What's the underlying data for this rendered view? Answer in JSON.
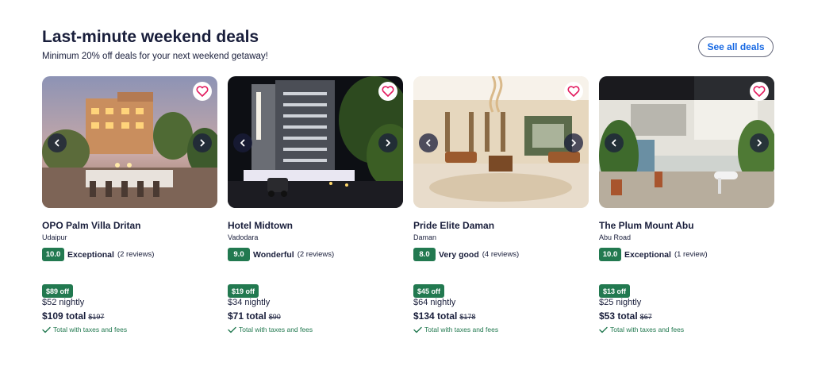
{
  "header": {
    "title": "Last-minute weekend deals",
    "subtitle": "Minimum 20% off deals for your next weekend getaway!",
    "see_all_label": "See all deals"
  },
  "colors": {
    "accent_link": "#1668e3",
    "rating_green": "#227950",
    "favorite_heart": "#e31c5f",
    "text_dark": "#191e3b"
  },
  "icons": {
    "favorite": "heart-outline-icon",
    "previous": "chevron-left-icon",
    "next": "chevron-right-icon",
    "included": "check-icon"
  },
  "cards": [
    {
      "name": "OPO Palm Villa Dritan",
      "location": "Udaipur",
      "score": "10.0",
      "rating_label": "Exceptional",
      "reviews": "(2 reviews)",
      "discount": "$89 off",
      "nightly": "$52 nightly",
      "total": "$109 total",
      "original_total": "$197",
      "taxes_note": "Total with taxes and fees"
    },
    {
      "name": "Hotel Midtown",
      "location": "Vadodara",
      "score": "9.0",
      "rating_label": "Wonderful",
      "reviews": "(2 reviews)",
      "discount": "$19 off",
      "nightly": "$34 nightly",
      "total": "$71 total",
      "original_total": "$90",
      "taxes_note": "Total with taxes and fees"
    },
    {
      "name": "Pride Elite Daman",
      "location": "Daman",
      "score": "8.0",
      "rating_label": "Very good",
      "reviews": "(4 reviews)",
      "discount": "$45 off",
      "nightly": "$64 nightly",
      "total": "$134 total",
      "original_total": "$178",
      "taxes_note": "Total with taxes and fees"
    },
    {
      "name": "The Plum Mount Abu",
      "location": "Abu Road",
      "score": "10.0",
      "rating_label": "Exceptional",
      "reviews": "(1 review)",
      "discount": "$13 off",
      "nightly": "$25 nightly",
      "total": "$53 total",
      "original_total": "$67",
      "taxes_note": "Total with taxes and fees"
    }
  ]
}
